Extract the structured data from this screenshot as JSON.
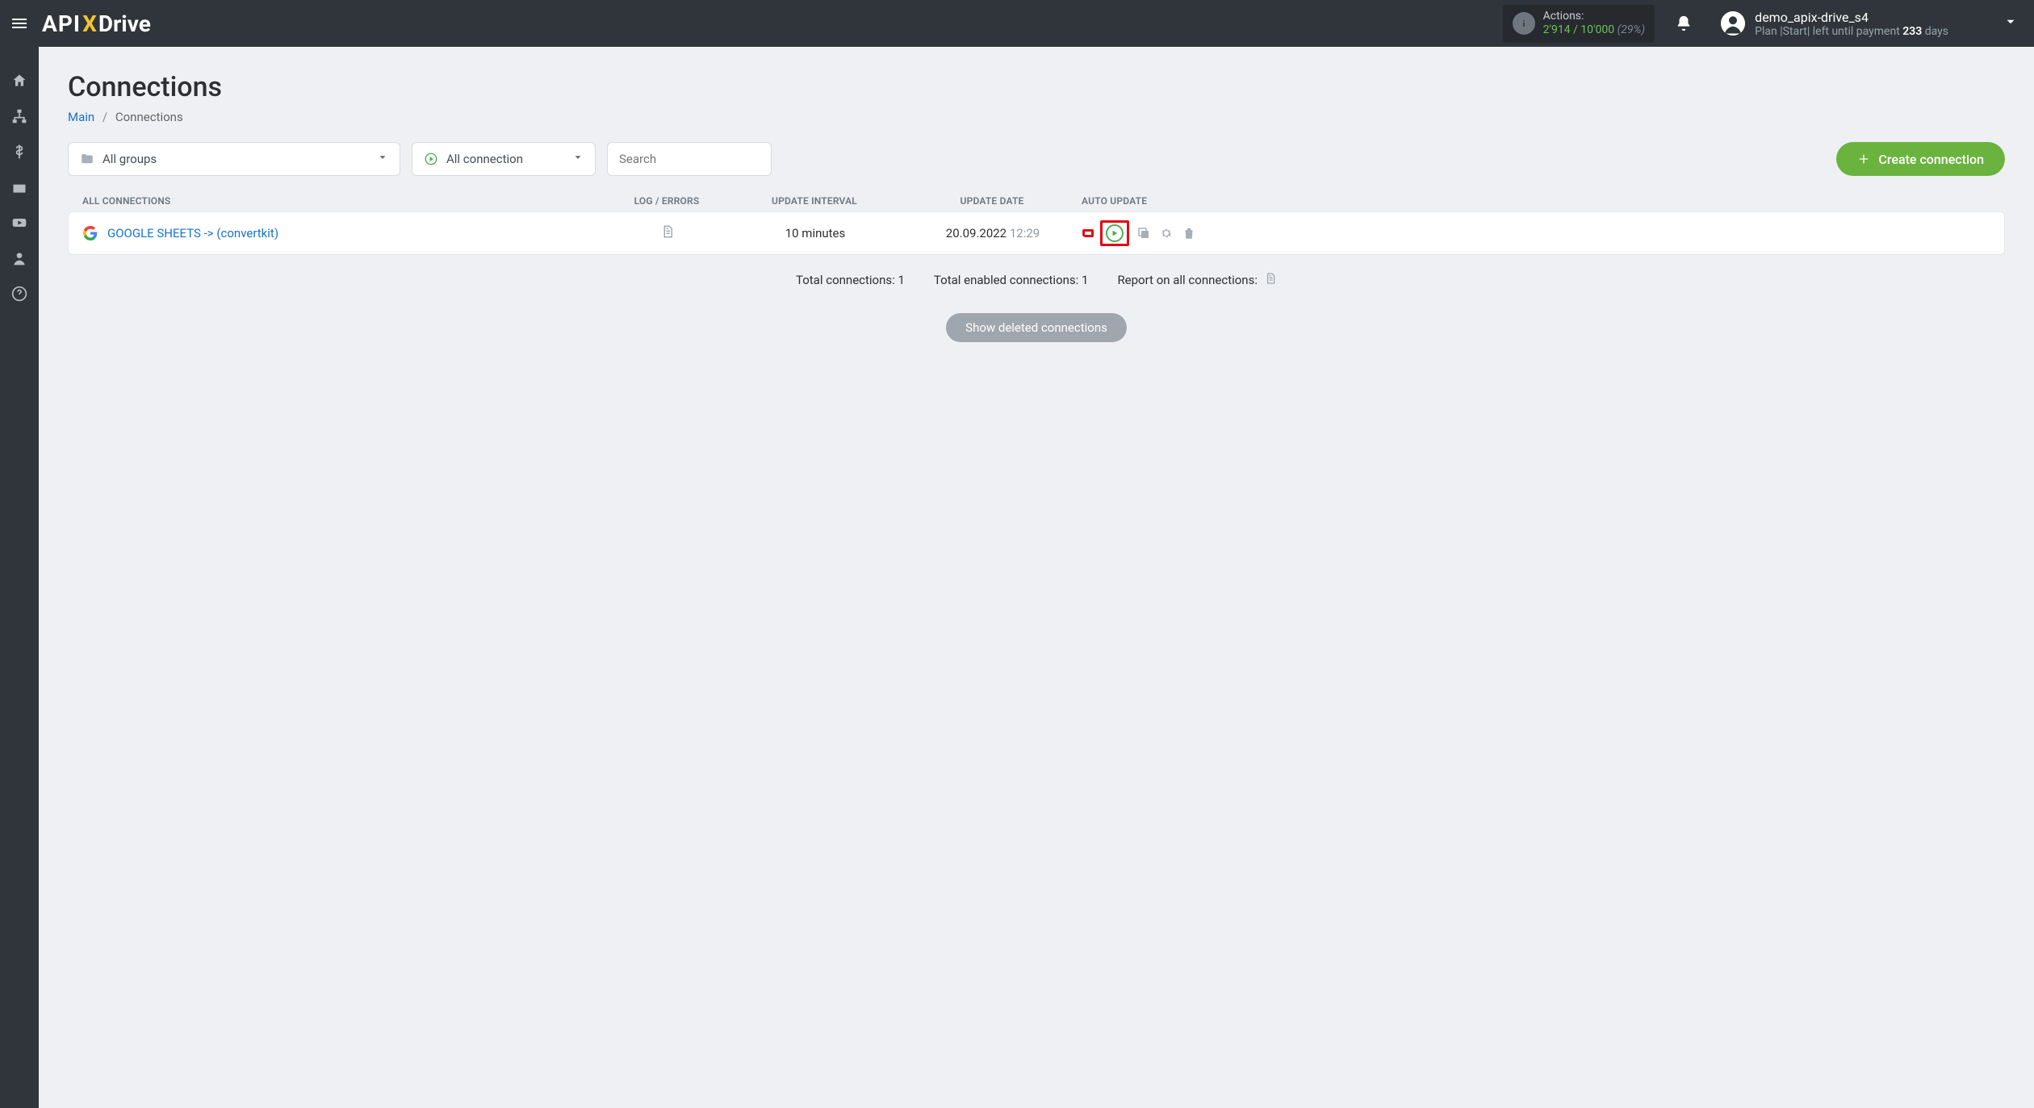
{
  "header": {
    "actions": {
      "label": "Actions:",
      "current": "2'914",
      "max": "10'000",
      "percent": "(29%)"
    },
    "user": {
      "name": "demo_apix-drive_s4",
      "plan_prefix": "Plan |Start| left until payment ",
      "days": "233",
      "days_suffix": " days"
    }
  },
  "page": {
    "title": "Connections",
    "breadcrumb": {
      "main": "Main",
      "current": "Connections"
    }
  },
  "filters": {
    "groups": "All groups",
    "status": "All connection",
    "search_placeholder": "Search",
    "create": "Create connection"
  },
  "columns": {
    "c1": "ALL CONNECTIONS",
    "c2": "LOG / ERRORS",
    "c3": "UPDATE INTERVAL",
    "c4": "UPDATE DATE",
    "c5": "AUTO UPDATE"
  },
  "rows": [
    {
      "name": "GOOGLE SHEETS -> (convertkit)",
      "interval": "10 minutes",
      "date": "20.09.2022",
      "time": "12:29"
    }
  ],
  "summary": {
    "total": "Total connections: 1",
    "enabled": "Total enabled connections: 1",
    "report": "Report on all connections:"
  },
  "show_deleted": "Show deleted connections"
}
